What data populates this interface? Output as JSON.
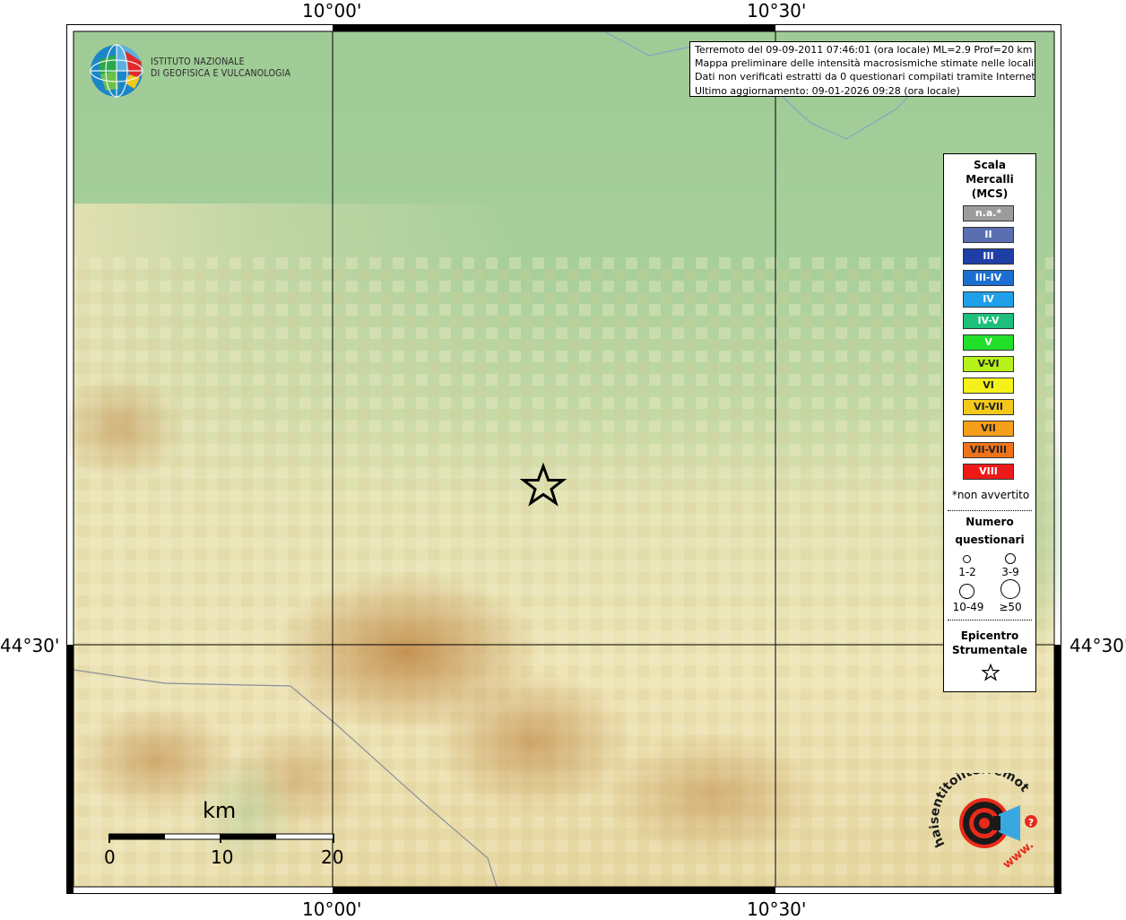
{
  "map": {
    "coord_labels": {
      "top": [
        "10°00'",
        "10°30'"
      ],
      "bottom": [
        "10°00'",
        "10°30'"
      ],
      "left": "44°30'",
      "right": "44°30'"
    },
    "colors": {
      "plain": "#a4cc98",
      "hills": "#ece3b4",
      "mountains": "#c89a58",
      "grid": "#000000",
      "frame": "#000000"
    },
    "epicenter_icon": "star-icon"
  },
  "info_box": {
    "line1": "Terremoto del 09-09-2011 07:46:01 (ora locale) ML=2.9 Prof=20 km",
    "line2": "Mappa preliminare delle intensità macrosismiche stimate nelle località",
    "line3": "Dati non verificati estratti da 0 questionari compilati tramite Internet.",
    "line4": "Ultimo aggiornamento: 09-01-2026 09:28 (ora locale)"
  },
  "ingv_logo": {
    "line1": "ISTITUTO NAZIONALE",
    "line2": "DI GEOFISICA E VULCANOLOGIA"
  },
  "legend": {
    "title1": "Scala",
    "title2": "Mercalli",
    "title3": "(MCS)",
    "intensities": [
      {
        "label": "n.a.*",
        "color": "#9c9c9c"
      },
      {
        "label": "II",
        "color": "#5a6fb0"
      },
      {
        "label": "III",
        "color": "#1f3fa6"
      },
      {
        "label": "III-IV",
        "color": "#1c6fd0"
      },
      {
        "label": "IV",
        "color": "#1fa0e8"
      },
      {
        "label": "IV-V",
        "color": "#1cc07a"
      },
      {
        "label": "V",
        "color": "#22e02a"
      },
      {
        "label": "V-VI",
        "color": "#b6f21a"
      },
      {
        "label": "VI",
        "color": "#f5f21a"
      },
      {
        "label": "VI-VII",
        "color": "#f2c81a"
      },
      {
        "label": "VII",
        "color": "#f59f1a"
      },
      {
        "label": "VII-VIII",
        "color": "#f0731a"
      },
      {
        "label": "VIII",
        "color": "#ee1a1a"
      }
    ],
    "not_felt_note": "*non avvertito",
    "count_title1": "Numero",
    "count_title2": "questionari",
    "counts": [
      "1-2",
      "3-9",
      "10-49",
      "≥50"
    ],
    "epicenter_title1": "Epicentro",
    "epicenter_title2": "Strumentale"
  },
  "scale_bar": {
    "unit": "km",
    "ticks": [
      "0",
      "10",
      "20"
    ]
  },
  "hsit_logo": {
    "text": "haisentitoilterremoto.it",
    "prefix": "www.",
    "badge": "?"
  }
}
